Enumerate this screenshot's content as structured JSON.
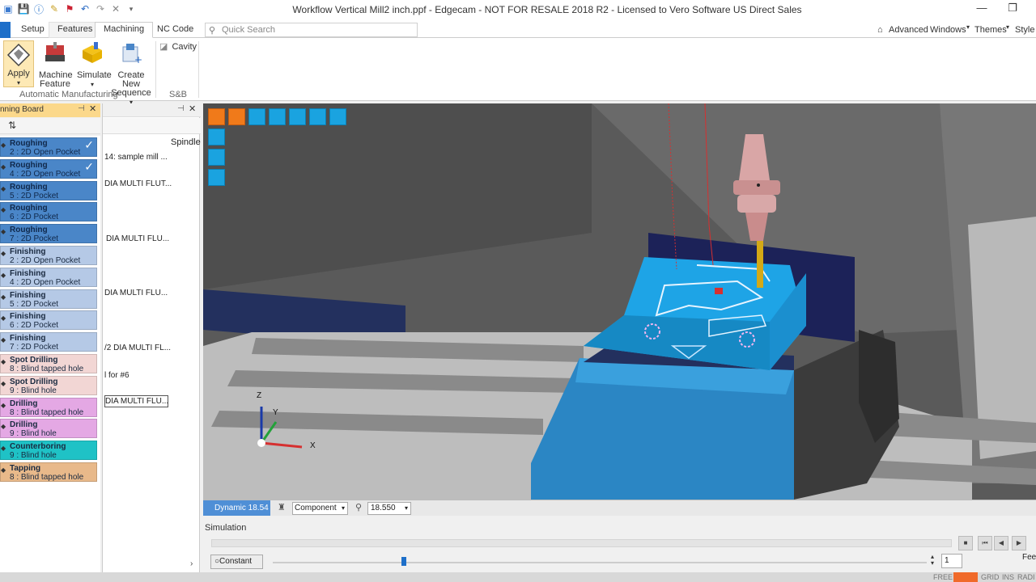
{
  "window": {
    "title": "Workflow Vertical Mill2 inch.ppf - Edgecam - NOT FOR RESALE 2018 R2  -  Licensed to Vero Software US Direct Sales"
  },
  "tabs": [
    {
      "label": "Setup"
    },
    {
      "label": "Features"
    },
    {
      "label": "Machining"
    },
    {
      "label": "NC Code"
    }
  ],
  "search": {
    "placeholder": "Quick Search"
  },
  "ribbon_right": {
    "advanced": "Advanced",
    "windows": "Windows",
    "themes": "Themes",
    "style": "Style"
  },
  "ribbon": {
    "apply": "Apply",
    "machine_feature": [
      "Machine",
      "Feature"
    ],
    "simulate": "Simulate",
    "create_new_sequence": [
      "Create New",
      "Sequence"
    ],
    "cavity": "Cavity",
    "group_automatic": "Automatic Manufacturing",
    "group_sb": "S&B"
  },
  "planning_board": {
    "title": "nning Board",
    "operations": [
      {
        "name": "Roughing",
        "detail": "2 : 2D Open Pocket",
        "color": "#4a86c8",
        "checked": true
      },
      {
        "name": "Roughing",
        "detail": "4 : 2D Open Pocket",
        "color": "#4a86c8",
        "checked": true
      },
      {
        "name": "Roughing",
        "detail": "5 : 2D Pocket",
        "color": "#4a86c8"
      },
      {
        "name": "Roughing",
        "detail": "6 : 2D Pocket",
        "color": "#4a86c8"
      },
      {
        "name": "Roughing",
        "detail": "7 : 2D Pocket",
        "color": "#4a86c8"
      },
      {
        "name": "Finishing",
        "detail": "2 : 2D Open Pocket",
        "color": "#b5c9e6"
      },
      {
        "name": "Finishing",
        "detail": "4 : 2D Open Pocket",
        "color": "#b5c9e6"
      },
      {
        "name": "Finishing",
        "detail": "5 : 2D Pocket",
        "color": "#b5c9e6"
      },
      {
        "name": "Finishing",
        "detail": "6 : 2D Pocket",
        "color": "#b5c9e6"
      },
      {
        "name": "Finishing",
        "detail": "7 : 2D Pocket",
        "color": "#b5c9e6"
      },
      {
        "name": "Spot Drilling",
        "detail": "8 : Blind tapped hole",
        "color": "#f2d6d4"
      },
      {
        "name": "Spot Drilling",
        "detail": "9 : Blind hole",
        "color": "#f2d6d4"
      },
      {
        "name": "Drilling",
        "detail": "8 : Blind tapped hole",
        "color": "#e4a8e4"
      },
      {
        "name": "Drilling",
        "detail": "9 : Blind hole",
        "color": "#e4a8e4"
      },
      {
        "name": "Counterboring",
        "detail": "9 : Blind hole",
        "color": "#1fc2c6"
      },
      {
        "name": "Tapping",
        "detail": "8 : Blind tapped hole",
        "color": "#e8b98a"
      }
    ]
  },
  "sequence": {
    "column": "Spindle",
    "items": [
      "14: sample mill ...",
      "DIA MULTI FLUT...",
      " DIA MULTI FLU...",
      "DIA MULTI FLU...",
      "/2 DIA MULTI FL...",
      "l for #6",
      "DIA MULTI FLU..."
    ]
  },
  "viewport": {
    "axis_x": "X",
    "axis_y": "Y",
    "axis_z": "Z"
  },
  "viewbar": {
    "mode": "Dynamic 18.54",
    "component": "Component",
    "distance": "18.550"
  },
  "simulation": {
    "label": "Simulation",
    "speed_mode": "Constant",
    "step": "1",
    "feed": "Fee",
    "speed_position": 0.2
  },
  "status": {
    "items": [
      "FREE",
      "",
      "GRID",
      "INS",
      "RADI"
    ]
  }
}
